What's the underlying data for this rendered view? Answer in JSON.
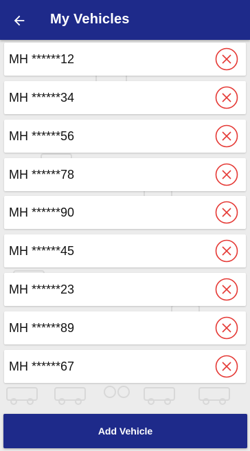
{
  "appbar": {
    "title": "My Vehicles",
    "back_icon": "arrow-left-icon",
    "background": "#1e2a8a"
  },
  "vehicles": [
    {
      "plate": "MH ******12"
    },
    {
      "plate": "MH ******34"
    },
    {
      "plate": "MH ******56"
    },
    {
      "plate": "MH ******78"
    },
    {
      "plate": "MH ******90"
    },
    {
      "plate": "MH ******45"
    },
    {
      "plate": "MH ******23"
    },
    {
      "plate": "MH ******89"
    },
    {
      "plate": "MH ******67"
    }
  ],
  "remove_icon": "close-circle-icon",
  "remove_color": "#e53935",
  "add_button": {
    "label": "Add Vehicle",
    "background": "#1e2a8a"
  }
}
